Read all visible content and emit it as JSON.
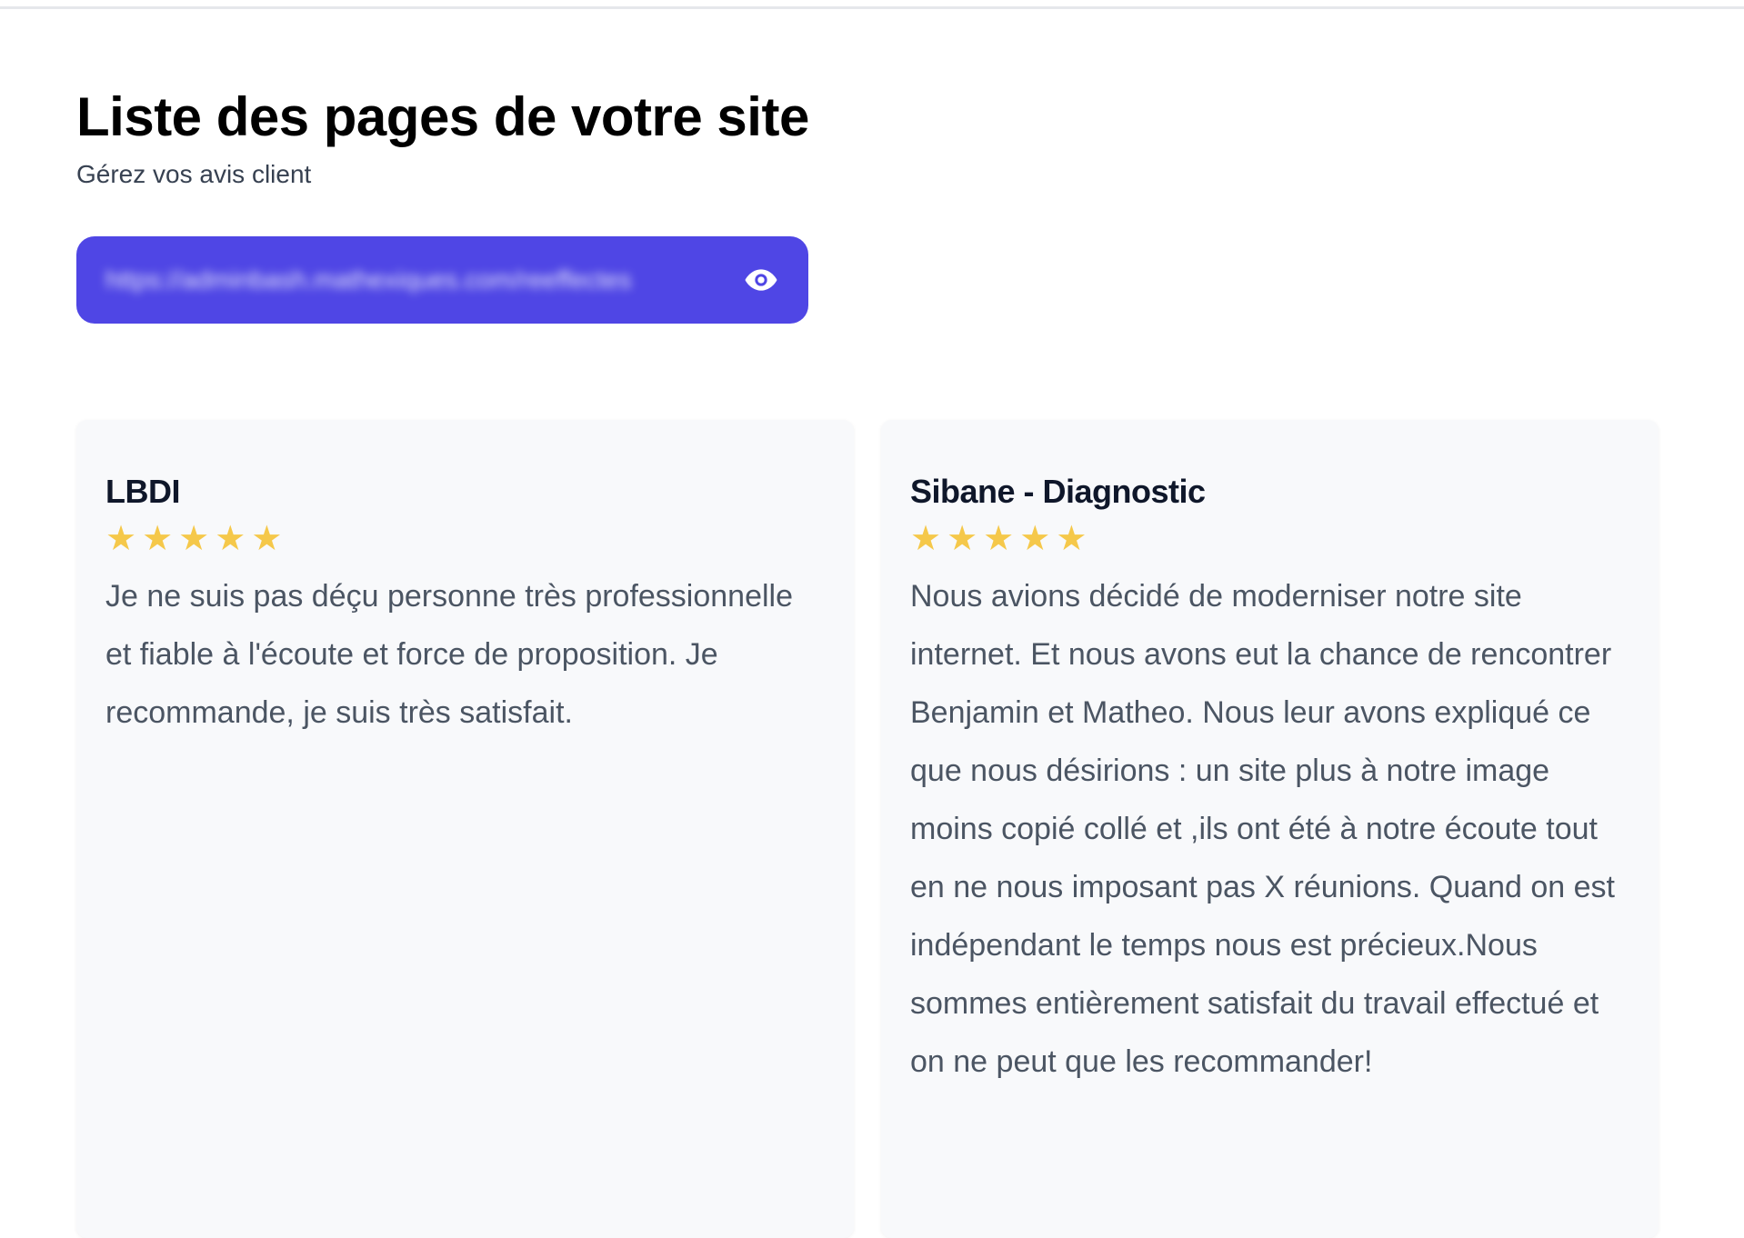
{
  "page": {
    "title": "Liste des pages de votre site",
    "subtitle": "Gérez vos avis client"
  },
  "url_bar": {
    "url": "https://adminbash.mathexiques.com/reeffectes",
    "icon": "eye-icon",
    "color": "#4f46e5"
  },
  "reviews": [
    {
      "name": "LBDI",
      "rating": 5,
      "text": "Je ne suis pas déçu personne très professionnelle et fiable à l'écoute et force de proposition. Je recommande, je suis très satisfait."
    },
    {
      "name": "Sibane - Diagnostic",
      "rating": 5,
      "text": "Nous avions décidé de moderniser notre site internet. Et nous avons eut la chance de rencontrer Benjamin et Matheo. Nous leur avons expliqué ce que nous désirions : un site plus à notre image moins copié collé et ,ils ont été à notre écoute tout en ne nous imposant pas X réunions. Quand on est indépendant le temps nous est précieux.Nous sommes entièrement satisfait du travail effectué et on ne peut que les recommander!"
    }
  ],
  "colors": {
    "star": "#f5c84a",
    "accent": "#4f46e5"
  }
}
